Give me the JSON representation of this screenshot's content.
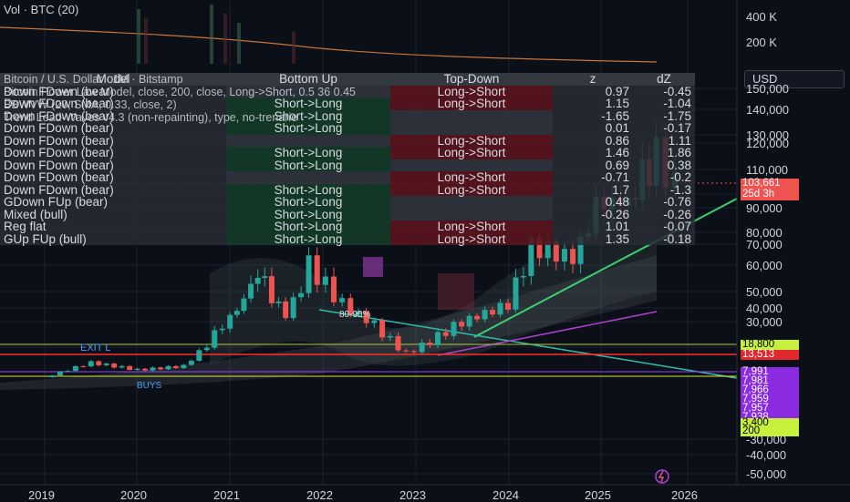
{
  "header": {
    "volume_label": "Vol · BTC (20)",
    "symbol_title": "Bitcoin / U.S. Dollar · 1M · Bitstamp",
    "indicator_1": "BBWVW (20, SMA, 0.33, close, 2)",
    "indicator_2": "Bitcoin Power Law Model, close, 200, close, Long->Short, 0.5 36 0.45",
    "indicator_3": "Trend Lead-Waves v4.3 (non-repainting), type, no-trenarie"
  },
  "table": {
    "headers": [
      "Model",
      "Bottom Up",
      "Top-Down",
      "z",
      "dZ"
    ],
    "rows": [
      {
        "model": "Down FDown (bear)",
        "bottom_up": "",
        "top_down": "Long->Short",
        "z": "0.97",
        "dz": "-0.45"
      },
      {
        "model": "Down FDown (bear)",
        "bottom_up": "Short->Long",
        "top_down": "Long->Short",
        "z": "1.15",
        "dz": "-1.04"
      },
      {
        "model": "Down FDown (bear)",
        "bottom_up": "Short->Long",
        "top_down": "",
        "z": "-1.65",
        "dz": "-1.75"
      },
      {
        "model": "Down FDown (bear)",
        "bottom_up": "Short->Long",
        "top_down": "",
        "z": "0.01",
        "dz": "-0.17"
      },
      {
        "model": "Down FDown (bear)",
        "bottom_up": "",
        "top_down": "Long->Short",
        "z": "0.86",
        "dz": "1.11"
      },
      {
        "model": "Down FDown (bear)",
        "bottom_up": "Short->Long",
        "top_down": "Long->Short",
        "z": "1.46",
        "dz": "1.86"
      },
      {
        "model": "Down FDown (bear)",
        "bottom_up": "Short->Long",
        "top_down": "",
        "z": "0.69",
        "dz": "0.38"
      },
      {
        "model": "Down FDown (bear)",
        "bottom_up": "",
        "top_down": "Long->Short",
        "z": "-0.71",
        "dz": "-0.2"
      },
      {
        "model": "Down FDown (bear)",
        "bottom_up": "Short->Long",
        "top_down": "Long->Short",
        "z": "1.7",
        "dz": "-1.3"
      },
      {
        "model": "GDown FUp (bear)",
        "bottom_up": "Short->Long",
        "top_down": "",
        "z": "0.48",
        "dz": "-0.76"
      },
      {
        "model": "Mixed (bull)",
        "bottom_up": "Short->Long",
        "top_down": "",
        "z": "-0.26",
        "dz": "-0.26"
      },
      {
        "model": "Reg flat",
        "bottom_up": "Short->Long",
        "top_down": "Long->Short",
        "z": "1.01",
        "dz": "-0.07"
      },
      {
        "model": "GUp FUp (bull)",
        "bottom_up": "Short->Long",
        "top_down": "Long->Short",
        "z": "1.35",
        "dz": "-0.18"
      }
    ]
  },
  "y_axis": {
    "currency": "USD",
    "volume_ticks": [
      "400 K",
      "200 K"
    ],
    "price_ticks": [
      "150,000",
      "140,000",
      "130,000",
      "120,000",
      "110,000",
      "100,000",
      "90,000",
      "80,000",
      "70,000",
      "60,000",
      "50,000",
      "40,000",
      "30,000",
      "20,000",
      "-30,000",
      "-40,000",
      "-50,000"
    ],
    "price_tag": "103,661",
    "countdown": "25d 3h",
    "level_tags": [
      {
        "value": "18,800",
        "color": "#c6f03b",
        "text_color": "#000000"
      },
      {
        "value": "13,513",
        "color": "#e0282e",
        "text_color": "#ffffff"
      },
      {
        "value": "7,991",
        "color": "#8a2be2",
        "text_color": "#ffffff"
      },
      {
        "value": "7,981",
        "color": "#8a2be2",
        "text_color": "#ffffff"
      },
      {
        "value": "7,966",
        "color": "#8a2be2",
        "text_color": "#ffffff"
      },
      {
        "value": "7,959",
        "color": "#8a2be2",
        "text_color": "#ffffff"
      },
      {
        "value": "7,957",
        "color": "#8a2be2",
        "text_color": "#ffffff"
      },
      {
        "value": "7,938",
        "color": "#8a2be2",
        "text_color": "#ffffff"
      },
      {
        "value": "3,400",
        "color": "#c6f03b",
        "text_color": "#000000"
      },
      {
        "value": "200",
        "color": "#c6f03b",
        "text_color": "#000000"
      }
    ]
  },
  "x_axis": {
    "years": [
      "2019",
      "2020",
      "2021",
      "2022",
      "2023",
      "2024",
      "2025",
      "2026"
    ]
  },
  "annotations": {
    "exit_long": "EXIT L",
    "pct_band": "80-90%",
    "buys": "BUYS"
  },
  "chart_data": {
    "type": "candlestick",
    "title": "Bitcoin / U.S. Dollar · 1M · Bitstamp",
    "x_labels": [
      "2019",
      "2020",
      "2021",
      "2022",
      "2023",
      "2024",
      "2025",
      "2026"
    ],
    "close_approx": [
      {
        "year": 2019.0,
        "value": 3400
      },
      {
        "year": 2019.5,
        "value": 11000
      },
      {
        "year": 2020.0,
        "value": 7200
      },
      {
        "year": 2020.5,
        "value": 9100
      },
      {
        "year": 2021.0,
        "value": 33000
      },
      {
        "year": 2021.3,
        "value": 58000
      },
      {
        "year": 2021.6,
        "value": 35000
      },
      {
        "year": 2021.85,
        "value": 61000
      },
      {
        "year": 2022.3,
        "value": 38000
      },
      {
        "year": 2022.9,
        "value": 16500
      },
      {
        "year": 2023.5,
        "value": 30000
      },
      {
        "year": 2024.0,
        "value": 42000
      },
      {
        "year": 2024.25,
        "value": 70000
      },
      {
        "year": 2024.7,
        "value": 63000
      },
      {
        "year": 2024.95,
        "value": 93000
      },
      {
        "year": 2025.3,
        "value": 95000
      },
      {
        "year": 2025.6,
        "value": 118000
      },
      {
        "year": 2025.8,
        "value": 103661
      }
    ],
    "ylabel": "USD",
    "current_price": 103661,
    "legend_position": "top-left"
  }
}
